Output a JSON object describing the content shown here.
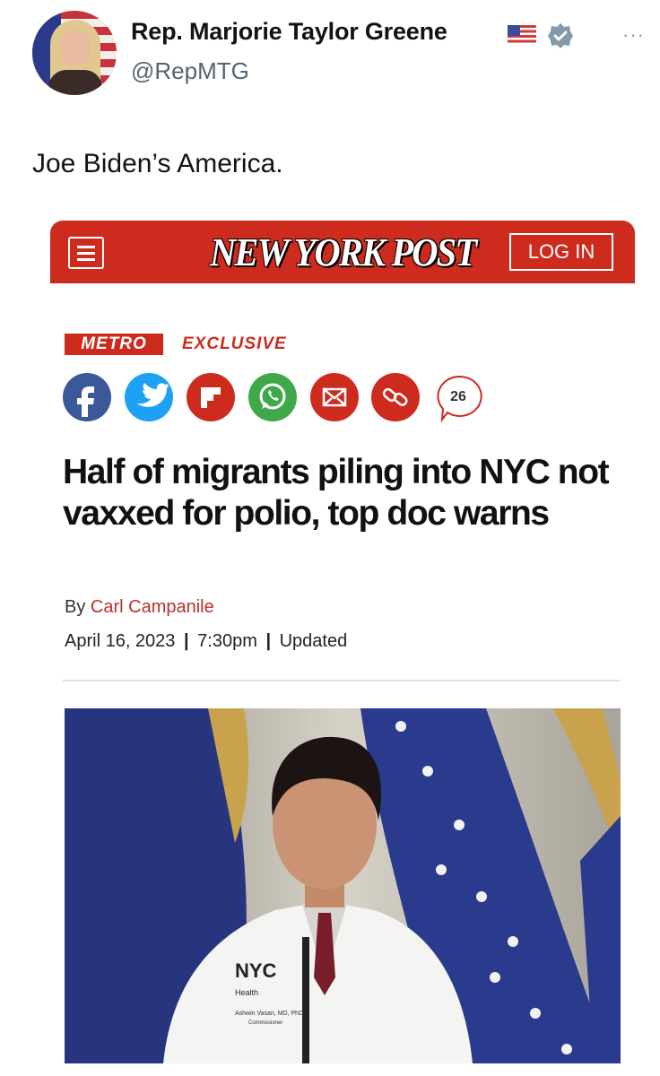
{
  "tweet": {
    "display_name": "Rep. Marjorie Taylor Greene",
    "name_emoji": "us-flag-emoji",
    "verified_icon": "verified-badge-icon",
    "handle": "@RepMTG",
    "more_label": "···",
    "text": "Joe Biden’s America."
  },
  "article": {
    "site_name": "NEW YORK POST",
    "login_label": "LOG IN",
    "section_tag": "METRO",
    "label_tag": "EXCLUSIVE",
    "share_icons": [
      "facebook-icon",
      "twitter-icon",
      "flipboard-icon",
      "whatsapp-icon",
      "email-icon",
      "link-icon"
    ],
    "comment_count": "26",
    "headline": "Half of migrants piling into NYC not vaxxed for polio, top doc warns",
    "byline_prefix": "By",
    "author": "Carl Campanile",
    "date": "April 16, 2023",
    "time": "7:30pm",
    "updated_label": "Updated",
    "photo_badge_logo": "NYC",
    "photo_badge_dept": "Health",
    "photo_badge_name": "Ashwin Vasan, MD, PhD.",
    "photo_badge_title": "Commissioner"
  },
  "colors": {
    "brand_red": "#cc2b1e",
    "facebook": "#3b5998",
    "twitter": "#1da1f2",
    "whatsapp": "#3fa94a",
    "verified": "#829aab"
  }
}
